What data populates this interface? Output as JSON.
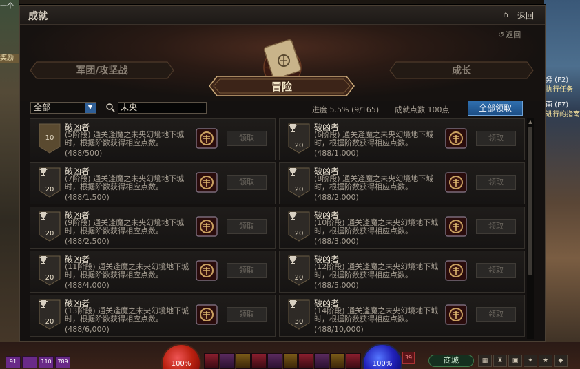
{
  "window": {
    "title": "成就",
    "back_label": "返回",
    "sub_back_label": "返回"
  },
  "categories": {
    "left": "军团/攻坚战",
    "center": "冒险",
    "right": "成长"
  },
  "filter": {
    "select_value": "全部",
    "search_value": "未央",
    "progress_text": "进度  5.5% (9/165)",
    "points_text": "成就点数 100点",
    "claim_all_label": "全部领取"
  },
  "achievements": [
    {
      "title": "破凶者",
      "desc": "(5阶段) 通关逢魔之未央幻境地下城时，根据阶数获得相应点数。",
      "progress": "(488/500)",
      "points": "10",
      "trophy": false,
      "claim": "领取"
    },
    {
      "title": "破凶者",
      "desc": "(6阶段) 通关逢魔之未央幻境地下城时，根据阶数获得相应点数。",
      "progress": "(488/1,000)",
      "points": "20",
      "trophy": true,
      "claim": "领取"
    },
    {
      "title": "破凶者",
      "desc": "(7阶段) 通关逢魔之未央幻境地下城时，根据阶数获得相应点数。",
      "progress": "(488/1,500)",
      "points": "20",
      "trophy": true,
      "claim": "领取"
    },
    {
      "title": "破凶者",
      "desc": "(8阶段) 通关逢魔之未央幻境地下城时，根据阶数获得相应点数。",
      "progress": "(488/2,000)",
      "points": "20",
      "trophy": true,
      "claim": "领取"
    },
    {
      "title": "破凶者",
      "desc": "(9阶段) 通关逢魔之未央幻境地下城时，根据阶数获得相应点数。",
      "progress": "(488/2,500)",
      "points": "20",
      "trophy": true,
      "claim": "领取"
    },
    {
      "title": "破凶者",
      "desc": "(10阶段) 通关逢魔之未央幻境地下城时，根据阶数获得相应点数。",
      "progress": "(488/3,000)",
      "points": "20",
      "trophy": true,
      "claim": "领取"
    },
    {
      "title": "破凶者",
      "desc": "(11阶段) 通关逢魔之未央幻境地下城时，根据阶数获得相应点数。",
      "progress": "(488/4,000)",
      "points": "20",
      "trophy": true,
      "claim": "领取"
    },
    {
      "title": "破凶者",
      "desc": "(12阶段) 通关逢魔之未央幻境地下城时，根据阶数获得相应点数。",
      "progress": "(488/5,000)",
      "points": "20",
      "trophy": true,
      "claim": "领取"
    },
    {
      "title": "破凶者",
      "desc": "(13阶段) 通关逢魔之未央幻境地下城时，根据阶数获得相应点数。",
      "progress": "(488/6,000)",
      "points": "20",
      "trophy": true,
      "claim": "领取"
    },
    {
      "title": "破凶者",
      "desc": "(14阶段) 通关逢魔之未央幻境地下城时，根据阶数获得相应点数。",
      "progress": "(488/10,000)",
      "points": "30",
      "trophy": true,
      "claim": "领取"
    }
  ],
  "hud": {
    "hp_text": "100%",
    "mp_text": "100%",
    "level_badge": "39",
    "shop_label": "商城",
    "left_counts": [
      "91",
      "110",
      "789"
    ]
  },
  "side_text": {
    "left_top": "一个",
    "left_tag": "奖励",
    "right_lines": [
      "务 (F2)",
      "执行任务",
      "南 (F7)",
      "进行的指南"
    ]
  },
  "colors": {
    "accent_blue": "#2f6fae",
    "gold_text": "#f3e6c8",
    "muted_text": "#a69e92"
  }
}
